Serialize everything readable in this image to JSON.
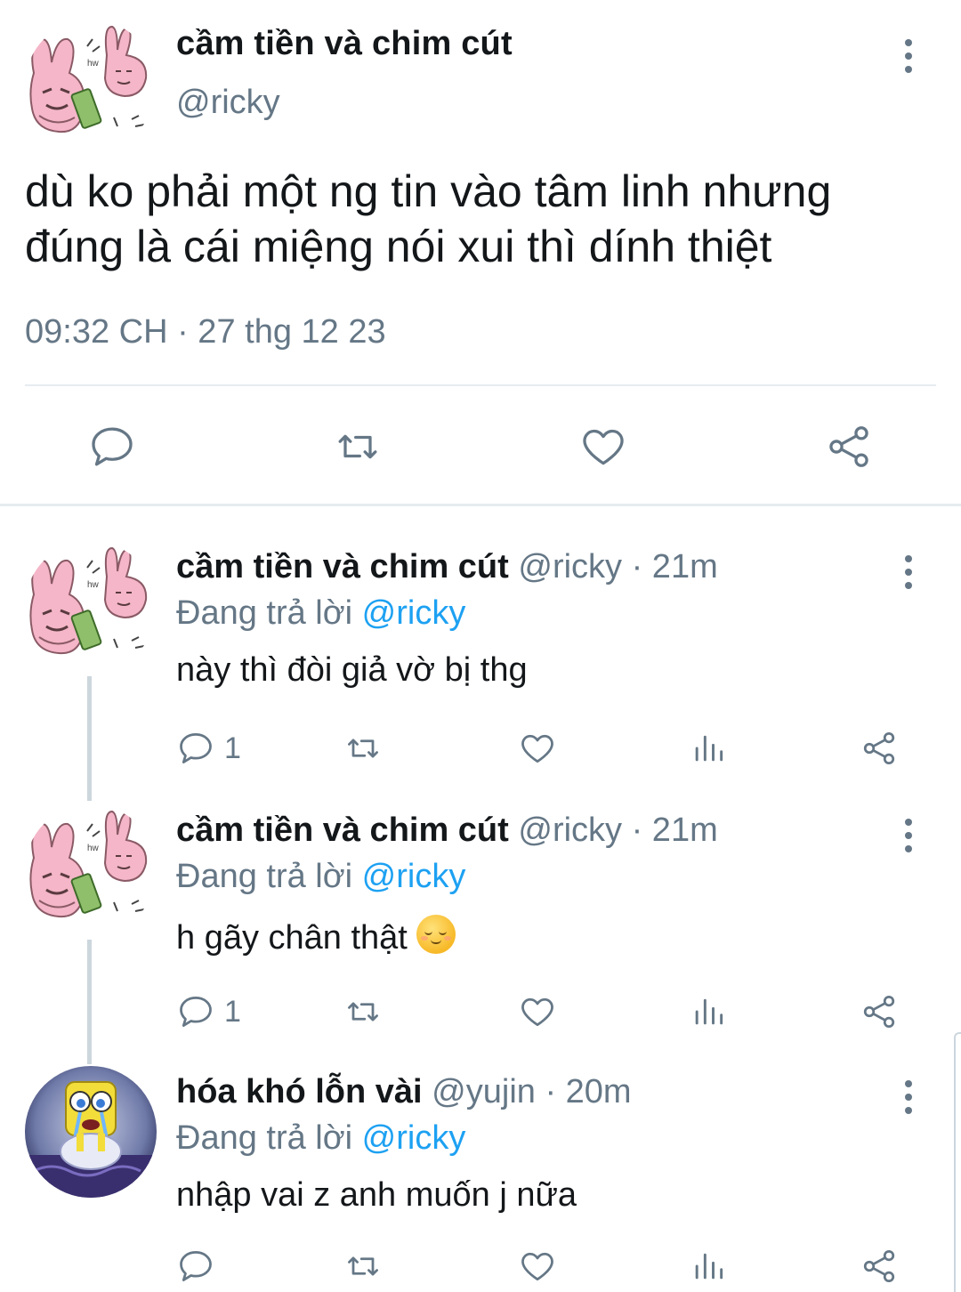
{
  "main_tweet": {
    "display_name": "cầm tiền và chim cút",
    "handle": "@ricky",
    "text": "dù ko phải một ng tin vào tâm linh nhưng đúng là cái miệng nói xui thì dính thiệt",
    "timestamp": "09:32 CH · 27 thg 12 23",
    "avatar_icon": "pink-rabbit-sticker-avatar",
    "actions": [
      "reply-icon",
      "retweet-icon",
      "like-icon",
      "share-icon"
    ]
  },
  "replies": [
    {
      "display_name": "cầm tiền và chim cút",
      "meta": " @ricky · 21m",
      "replying_label": "Đang trả lời ",
      "replying_to": "@ricky",
      "text": "này thì đòi giả vờ bị thg",
      "reply_count": "1",
      "avatar_icon": "pink-rabbit-sticker-avatar",
      "emoji": ""
    },
    {
      "display_name": "cầm tiền và chim cút",
      "meta": " @ricky · 21m",
      "replying_label": "Đang trả lời ",
      "replying_to": "@ricky",
      "text": "h gãy chân thật",
      "reply_count": "1",
      "avatar_icon": "pink-rabbit-sticker-avatar",
      "emoji": "relieved-face-emoji"
    },
    {
      "display_name": "hóa khó lỗn vài",
      "meta": " @yujin · 20m",
      "replying_label": "Đang trả lời ",
      "replying_to": "@ricky",
      "text": "nhập vai z anh muốn j nữa",
      "reply_count": "",
      "avatar_icon": "crying-spongebob-avatar",
      "emoji": ""
    }
  ],
  "colors": {
    "text": "#14171a",
    "secondary": "#657786",
    "link": "#1da1f2",
    "divider": "#e6ecf0",
    "thread_line": "#ccd6dd",
    "avatar_pink": "#f4b6c8"
  }
}
